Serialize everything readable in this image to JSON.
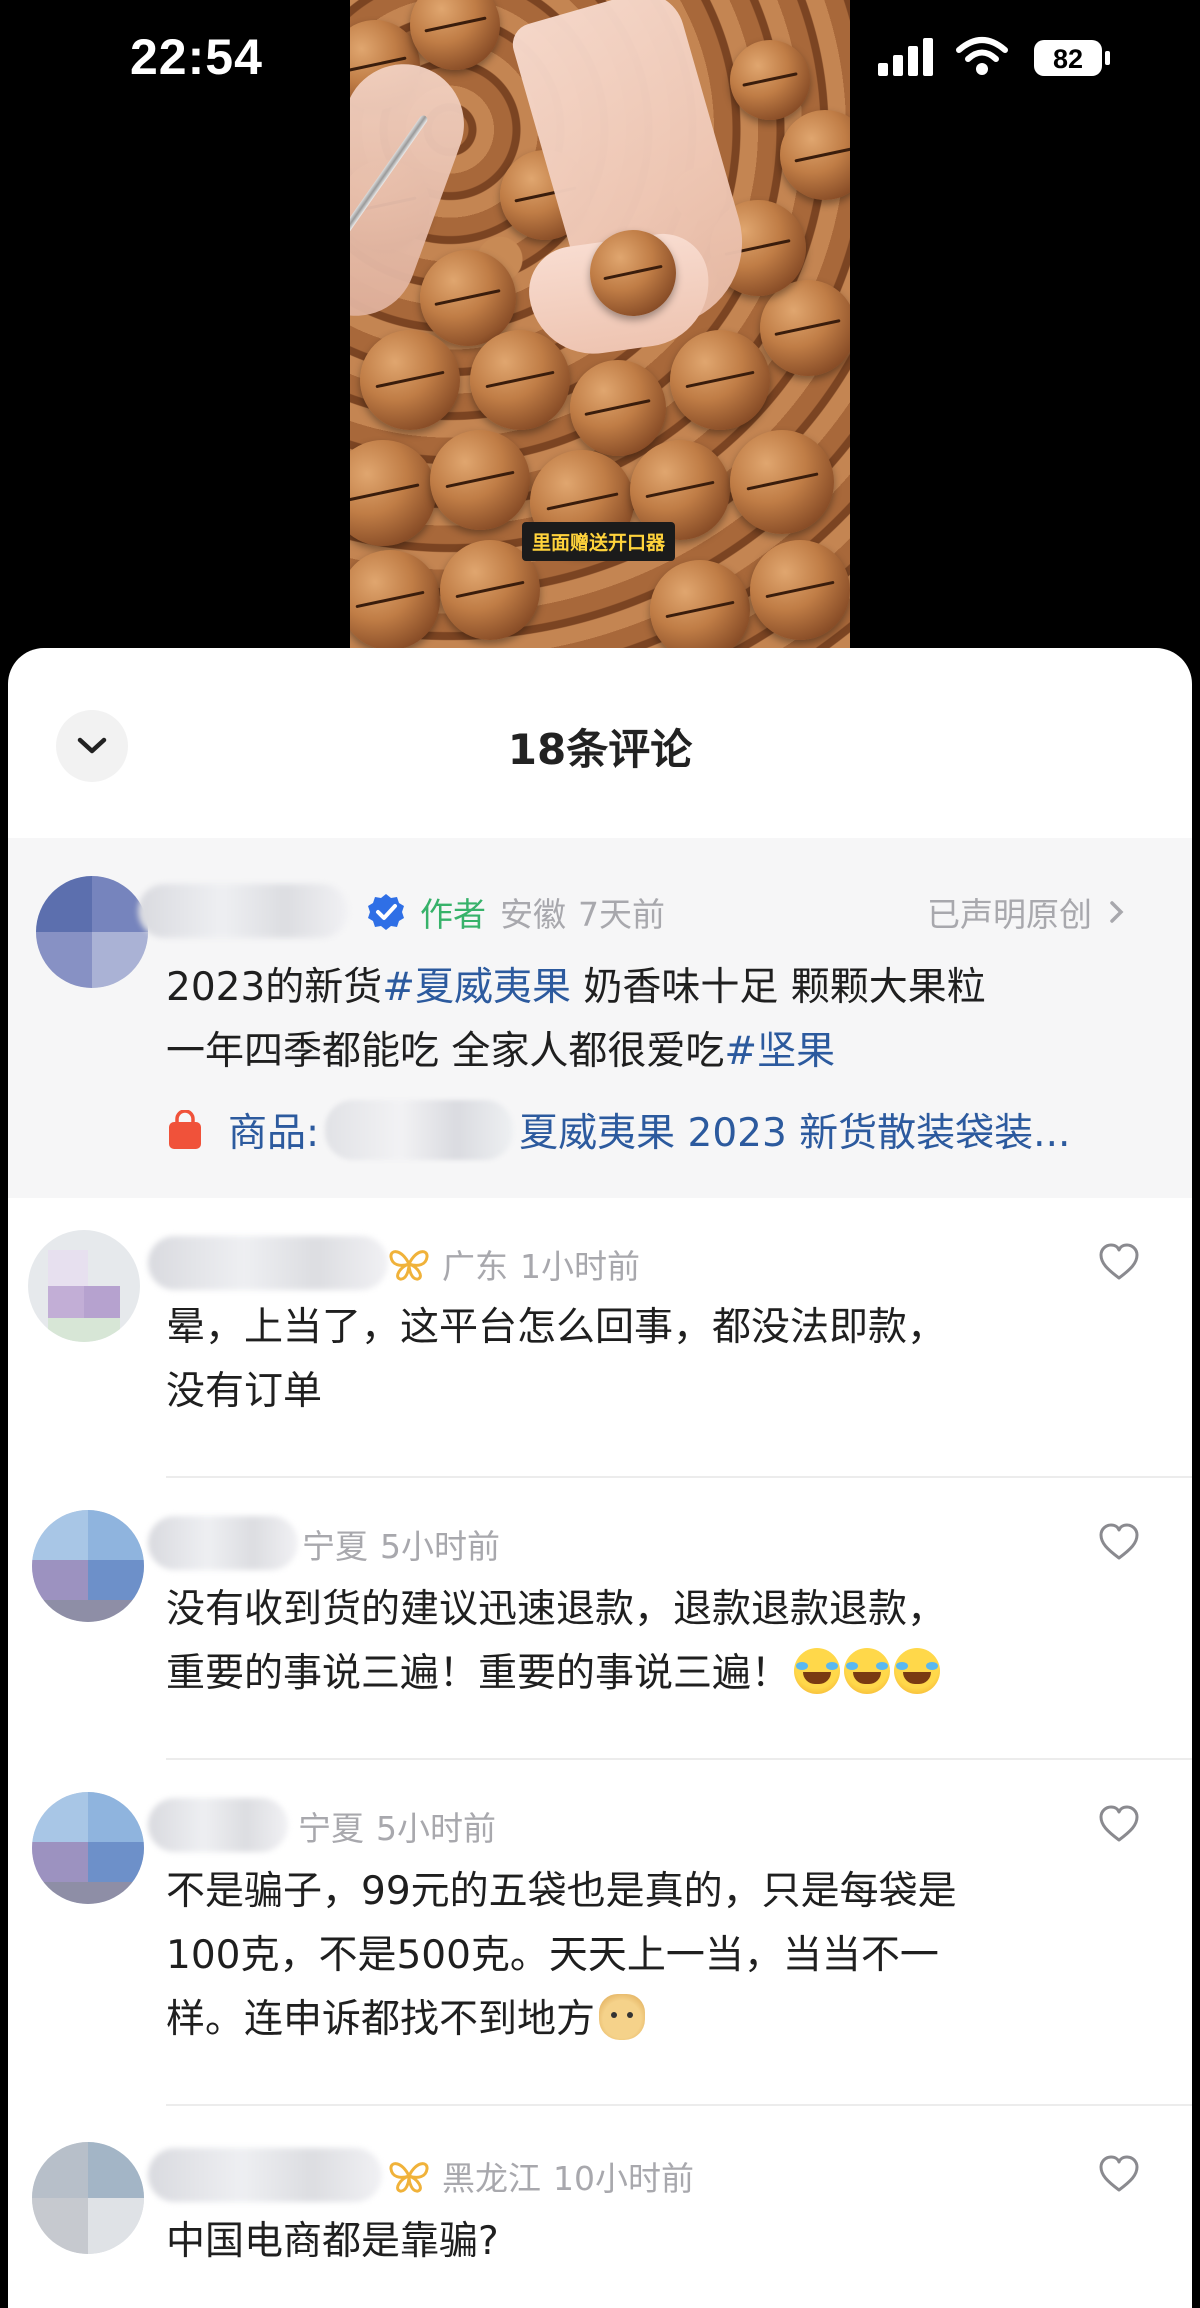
{
  "status_bar": {
    "time": "22:54",
    "battery": "82"
  },
  "video": {
    "caption": "里面赠送开口器"
  },
  "sheet": {
    "title": "18条评论"
  },
  "author_post": {
    "author_tag": "作者",
    "location": "安徽",
    "time": "7天前",
    "original_claim": "已声明原创",
    "text_line1_prefix": "2023的新货",
    "hashtag1": "#夏威夷果",
    "text_line1_suffix": " 奶香味十足 颗颗大果粒",
    "text_line2_prefix": "一年四季都能吃 全家人都很爱吃",
    "hashtag2": "#坚果",
    "product_label": "商品:",
    "product_name": "夏威夷果 2023 新货散装袋装..."
  },
  "comments": [
    {
      "location": "广东",
      "time": "1小时前",
      "line1": "晕，上当了，这平台怎么回事，都没法即款，",
      "line2": "没有订单"
    },
    {
      "location": "宁夏",
      "time": "5小时前",
      "line1": "没有收到货的建议迅速退款，退款退款退款，",
      "line2": "重要的事说三遍！重要的事说三遍！"
    },
    {
      "location": "宁夏",
      "time": "5小时前",
      "line1": "不是骗子，99元的五袋也是真的，只是每袋是",
      "line2": "100克，不是500克。天天上一当，当当不一",
      "line3": "样。连申诉都找不到地方"
    },
    {
      "location": "黑龙江",
      "time": "10小时前",
      "line1": "中国电商都是靠骗?"
    }
  ],
  "colors": {
    "hashtag": "#2c5a9e",
    "author_tag": "#37b26a",
    "verified": "#2f6fe6",
    "product_bag": "#f0523a",
    "meta_gray": "#a8a8ad"
  },
  "icons": {
    "collapse": "chevron-down-icon",
    "verified": "verified-check-icon",
    "product": "shopping-bag-icon",
    "like": "heart-icon",
    "badge": "butterfly-badge-icon"
  }
}
